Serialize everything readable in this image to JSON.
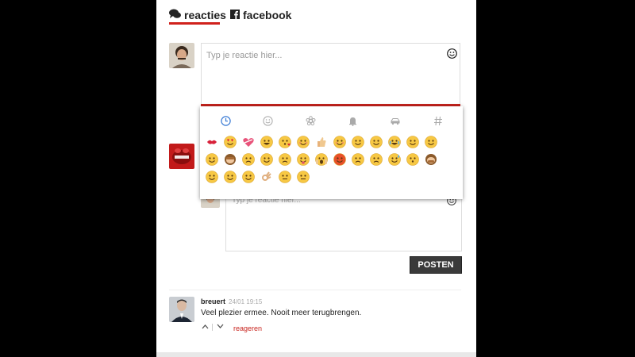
{
  "tabs": {
    "reacties": "reacties",
    "facebook": "facebook"
  },
  "composer": {
    "placeholder": "Typ je reactie hier..."
  },
  "reply_composer": {
    "placeholder": "Typ je reactie hier..."
  },
  "post_button": "POSTEN",
  "comment": {
    "user": "breuert",
    "time": "24/01 19:15",
    "text": "Veel plezier ermee. Nooit meer terugbrengen.",
    "reply_link": "reageren"
  },
  "emoji_picker": {
    "categories": [
      "recent-icon",
      "smiley-icon",
      "flower-icon",
      "bell-icon",
      "car-icon",
      "hashtag-icon"
    ],
    "emojis": [
      "kiss-lips",
      "heart-eyes",
      "heart-ribbon",
      "grinning-squint",
      "kissing-wink",
      "smiling",
      "thumbs-up",
      "blushing",
      "relieved",
      "grinning",
      "crying-laughing",
      "smirk",
      "flushed",
      "winking",
      "see-no-evil",
      "persevering",
      "smiley",
      "disappointed",
      "tongue-out",
      "screaming",
      "angry",
      "unamused",
      "sad",
      "sweat-smile",
      "kissing",
      "speak-no-evil",
      "sleepy",
      "smile",
      "grin",
      "ok-hand",
      "neutral",
      "confused"
    ]
  },
  "colors": {
    "accent": "#d0211c",
    "button": "#3a3a3a",
    "emoji_face": "#f7c844"
  }
}
